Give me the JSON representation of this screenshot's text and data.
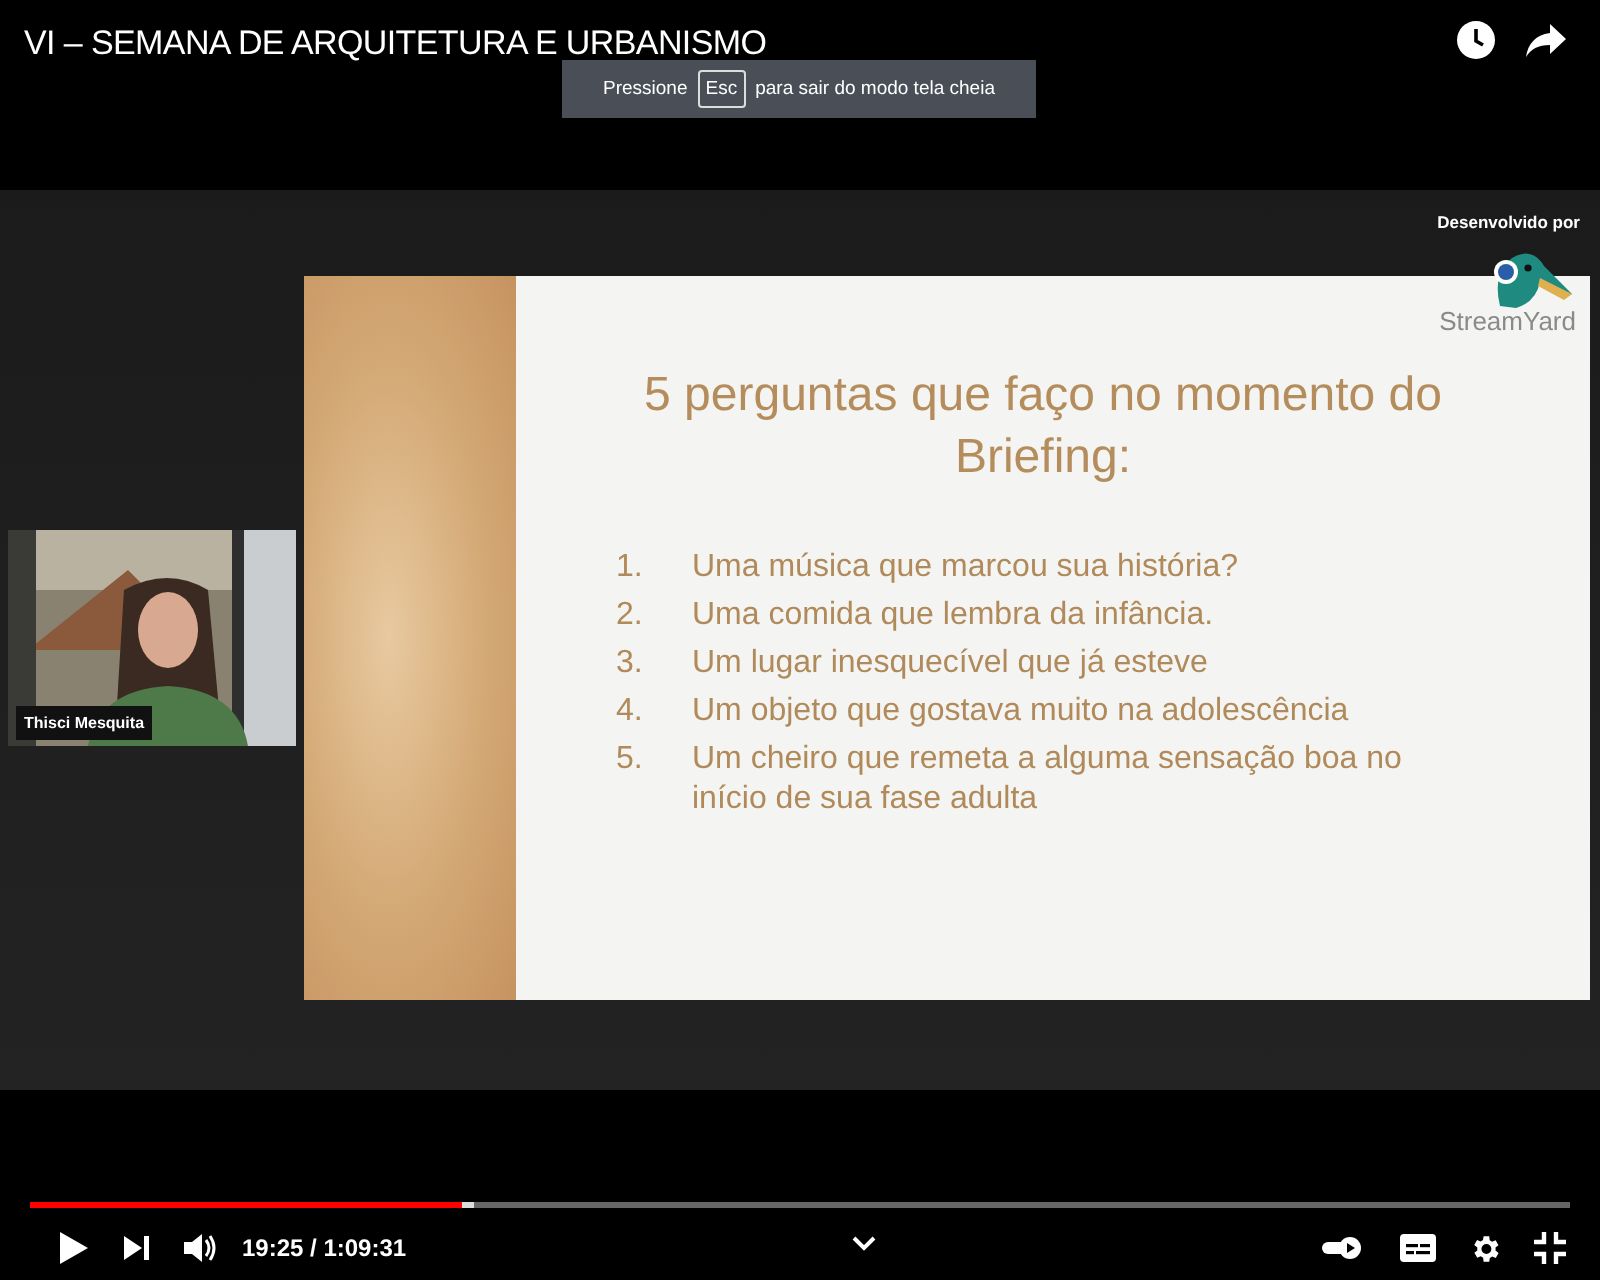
{
  "title": "VI – SEMANA DE ARQUITETURA E URBANISMO",
  "fullscreen_hint": {
    "before": "Pressione",
    "key": "Esc",
    "after": "para sair do modo tela cheia"
  },
  "stream": {
    "branding": "Desenvolvido por",
    "logo_text": "StreamYard",
    "camera": {
      "name": "Thisci Mesquita"
    },
    "slide": {
      "heading": "5 perguntas que faço no momento do Briefing:",
      "items": [
        {
          "number": "1.",
          "text": "Uma música que marcou sua história?"
        },
        {
          "number": "2.",
          "text": "Uma comida que lembra da infância."
        },
        {
          "number": "3.",
          "text": "Um lugar inesquecível que já esteve"
        },
        {
          "number": "4.",
          "text": "Um objeto que gostava muito na adolescência"
        },
        {
          "number": "5.",
          "text": "Um cheiro que remeta a alguma sensação boa no início de sua fase adulta"
        }
      ]
    }
  },
  "player": {
    "progress": {
      "level": 0.28
    },
    "time": "19:25 / 1:09:31",
    "autoplay": {
      "on": true
    }
  }
}
